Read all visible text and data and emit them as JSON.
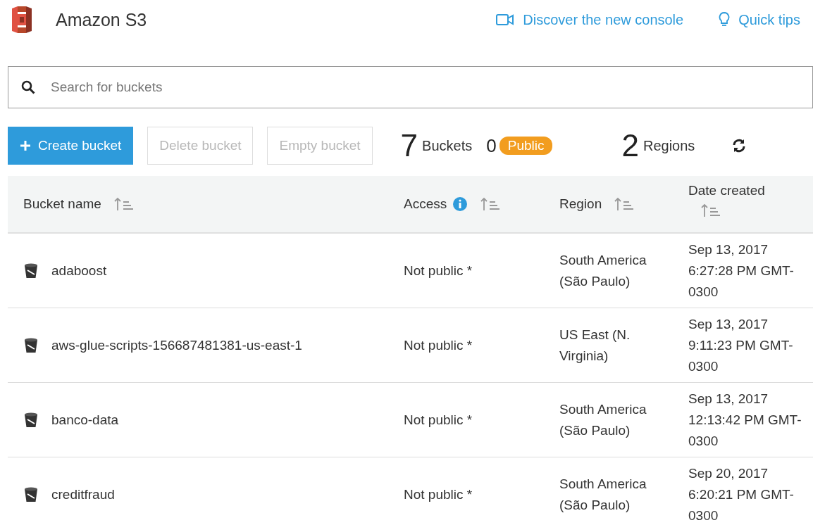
{
  "header": {
    "title": "Amazon S3",
    "links": [
      {
        "kind": "video",
        "label": "Discover the new console"
      },
      {
        "kind": "tips",
        "label": "Quick tips"
      }
    ]
  },
  "search": {
    "placeholder": "Search for buckets"
  },
  "actions": [
    {
      "label": "Create bucket",
      "kind": "primary",
      "disabled": false
    },
    {
      "label": "Delete bucket",
      "kind": "secondary",
      "disabled": true
    },
    {
      "label": "Empty bucket",
      "kind": "secondary",
      "disabled": true
    }
  ],
  "summary": {
    "buckets_count": "7",
    "buckets_label": "Buckets",
    "public_count": "0",
    "public_badge": "Public",
    "regions_count": "2",
    "regions_label": "Regions"
  },
  "table": {
    "columns": [
      {
        "label": "Bucket name",
        "info": false
      },
      {
        "label": "Access",
        "info": true
      },
      {
        "label": "Region",
        "info": false
      },
      {
        "label": "Date created",
        "info": false
      }
    ],
    "rows": [
      {
        "name": "adaboost",
        "access": "Not public *",
        "region": "South America (São Paulo)",
        "date": "Sep 13, 2017 6:27:28 PM GMT-0300"
      },
      {
        "name": "aws-glue-scripts-156687481381-us-east-1",
        "access": "Not public *",
        "region": "US East (N. Virginia)",
        "date": "Sep 13, 2017 9:11:23 PM GMT-0300"
      },
      {
        "name": "banco-data",
        "access": "Not public *",
        "region": "South America (São Paulo)",
        "date": "Sep 13, 2017 12:13:42 PM GMT-0300"
      },
      {
        "name": "creditfraud",
        "access": "Not public *",
        "region": "South America (São Paulo)",
        "date": "Sep 20, 2017 6:20:21 PM GMT-0300"
      }
    ]
  }
}
